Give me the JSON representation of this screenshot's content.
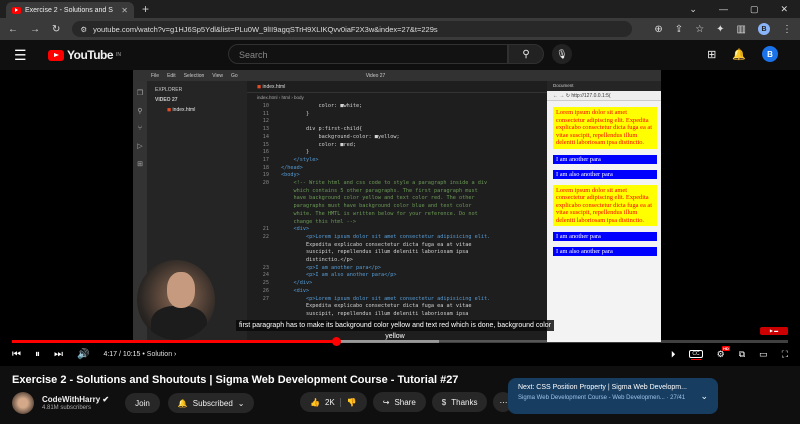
{
  "browser": {
    "tab_title": "Exercise 2 - Solutions and S",
    "url": "youtube.com/watch?v=g1HJ6Sp5Ydl&list=PLu0W_9lII9agqSTrH9XLIKQvv0iaF2X3w&index=27&t=229s"
  },
  "youtube": {
    "logo_text": "YouTube",
    "country": "IN",
    "search_placeholder": "Search",
    "avatar_letter": "B"
  },
  "vscode": {
    "menu": [
      "File",
      "Edit",
      "Selection",
      "View",
      "Go"
    ],
    "window_title": "Video 27",
    "explorer_title": "EXPLORER",
    "folder": "VIDEO 27",
    "file": "index.html",
    "tab": "index.html",
    "breadcrumb": [
      "index.html",
      "html",
      "body"
    ],
    "lines": [
      {
        "n": "10",
        "t": "            color: ■white;"
      },
      {
        "n": "11",
        "t": "        }"
      },
      {
        "n": "12",
        "t": ""
      },
      {
        "n": "13",
        "t": "        div p:first-child{"
      },
      {
        "n": "14",
        "t": "            background-color: ■yellow;"
      },
      {
        "n": "15",
        "t": "            color: ■red;"
      },
      {
        "n": "16",
        "t": "        }"
      },
      {
        "n": "17",
        "t": "    </style>"
      },
      {
        "n": "18",
        "t": "</head>"
      },
      {
        "n": "19",
        "t": "<body>"
      },
      {
        "n": "20",
        "t": "    <!-- Write html and css code to style a paragraph inside a div"
      },
      {
        "n": "",
        "t": "    which contains 5 other paragraphs. The first paragraph must"
      },
      {
        "n": "",
        "t": "    have background color yellow and text color red. The other"
      },
      {
        "n": "",
        "t": "    paragraphs must have background color blue and text color"
      },
      {
        "n": "",
        "t": "    white. The HMTL is written below for your reference. Do not"
      },
      {
        "n": "",
        "t": "    change this html -->"
      },
      {
        "n": "21",
        "t": "    <div>"
      },
      {
        "n": "22",
        "t": "        <p>Lorem ipsum dolor sit amet consectetur adipisicing elit."
      },
      {
        "n": "",
        "t": "        Expedita explicabo consectetur dicta fuga ea at vitae"
      },
      {
        "n": "",
        "t": "        suscipit, repellendus illum deleniti laboriosam ipsa"
      },
      {
        "n": "",
        "t": "        distinctio.</p>"
      },
      {
        "n": "23",
        "t": "        <p>I am another para</p>"
      },
      {
        "n": "24",
        "t": "        <p>I am also another para</p>"
      },
      {
        "n": "25",
        "t": "    </div>"
      },
      {
        "n": "26",
        "t": "    <div>"
      },
      {
        "n": "27",
        "t": "        <p>Lorem ipsum dolor sit amet consectetur adipisicing elit."
      },
      {
        "n": "",
        "t": "        Expedita explicabo consectetur dicta fuga ea at vitae"
      },
      {
        "n": "",
        "t": "        suscipit, repellendus illum deleniti laboriosam ipsa"
      }
    ],
    "status": "Ln 20, Col 173 (41 selected)   Spaces: 4   UTF-8   CRLF   HTML   Port : 5500",
    "preview_tab": "Document",
    "preview_url": "http://127.0.0.1:5(",
    "preview_paras": [
      {
        "style": "yellow",
        "text": "Lorem ipsum dolor sit amet consectetur adipiscing elit. Expedita explicabo consectetur dicta fuga ea at vitae suscipit, repellendus illum deleniti laboriosam ipsa distinctio."
      },
      {
        "style": "blue",
        "text": "I am another para"
      },
      {
        "style": "blue",
        "text": "I am also another para"
      },
      {
        "style": "yellow",
        "text": "Lorem ipsum dolor sit amet consectetur adipiscing elit. Expedita explicabo consectetur dicta fuga ea at vitae suscipit, repellendus illum deleniti laboriosam ipsa distinctio."
      },
      {
        "style": "blue",
        "text": "I am another para"
      },
      {
        "style": "blue",
        "text": "I am also another para"
      }
    ]
  },
  "player": {
    "caption": "first paragraph has to make its background color yellow and text red which is done, background color yellow",
    "current_time": "4:17",
    "duration": "10:15",
    "chapter": "Solution",
    "progress_fraction": 0.418,
    "hd_badge": "HD"
  },
  "video": {
    "title": "Exercise 2 - Solutions and Shoutouts | Sigma Web Development Course - Tutorial #27",
    "channel": "CodeWithHarry",
    "subscribers": "4.81M subscribers",
    "join": "Join",
    "subscribed": "Subscribed",
    "likes": "2K",
    "share": "Share",
    "thanks": "Thanks",
    "next_label": "Next: CSS Position Property | Sigma Web Developm...",
    "next_sub": "Sigma Web Development Course - Web Developmen... · 27/41"
  }
}
